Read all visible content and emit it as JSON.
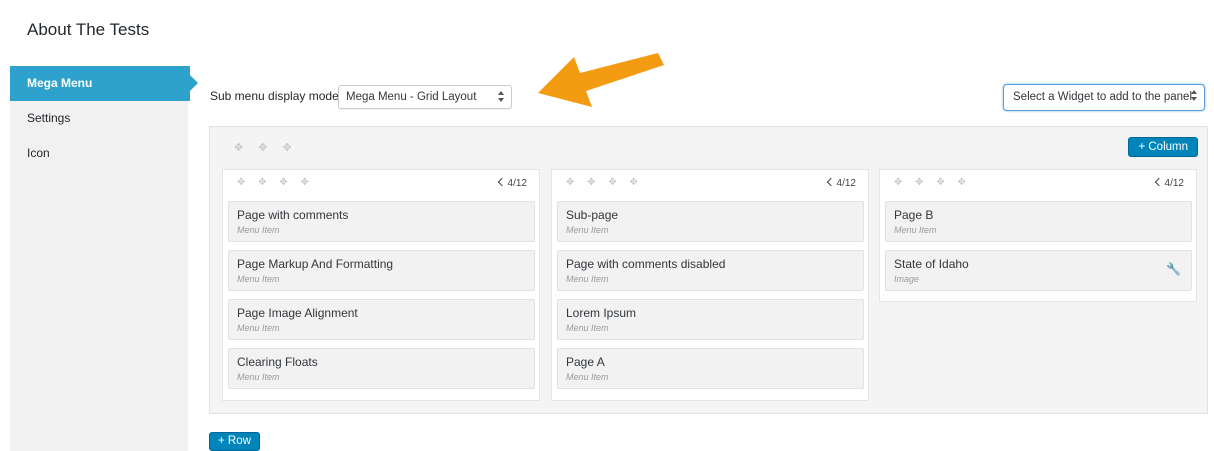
{
  "page": {
    "title": "About The Tests"
  },
  "sidebar": {
    "items": [
      {
        "label": "Mega Menu",
        "active": true
      },
      {
        "label": "Settings",
        "active": false
      },
      {
        "label": "Icon",
        "active": false
      }
    ]
  },
  "display_mode": {
    "label": "Sub menu display mode",
    "selected": "Mega Menu - Grid Layout"
  },
  "widget_select": {
    "selected": "Select a Widget to add to the panel"
  },
  "grid": {
    "add_column_label": "+ Column",
    "add_row_label": "+ Row",
    "columns": [
      {
        "width": "4/12",
        "items": [
          {
            "title": "Page with comments",
            "type": "Menu Item"
          },
          {
            "title": "Page Markup And Formatting",
            "type": "Menu Item"
          },
          {
            "title": "Page Image Alignment",
            "type": "Menu Item"
          },
          {
            "title": "Clearing Floats",
            "type": "Menu Item"
          }
        ]
      },
      {
        "width": "4/12",
        "items": [
          {
            "title": "Sub-page",
            "type": "Menu Item"
          },
          {
            "title": "Page with comments disabled",
            "type": "Menu Item"
          },
          {
            "title": "Lorem Ipsum",
            "type": "Menu Item"
          },
          {
            "title": "Page A",
            "type": "Menu Item"
          }
        ]
      },
      {
        "width": "4/12",
        "items": [
          {
            "title": "Page B",
            "type": "Menu Item"
          },
          {
            "title": "State of Idaho",
            "type": "Image"
          }
        ]
      }
    ]
  },
  "colors": {
    "accent": "#2ea2cc",
    "button": "#0085ba",
    "annotation_arrow": "#f39c12"
  }
}
